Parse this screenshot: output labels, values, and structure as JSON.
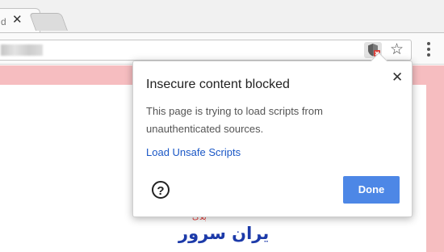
{
  "tabs": {
    "active_title_fragment": "d",
    "close_glyph": "✕"
  },
  "toolbar": {
    "shield_icon": "blocked-content-shield",
    "star_icon": "bookmark-star",
    "menu_icon": "vertical-dots",
    "star_glyph": "☆"
  },
  "popup": {
    "title": "Insecure content blocked",
    "close_glyph": "✕",
    "message": "This page is trying to load scripts from unauthenticated sources.",
    "link": "Load Unsafe Scripts",
    "help_glyph": "?",
    "done": "Done"
  },
  "logo": {
    "text": "ایران سرور",
    "subtext": "بلاگ",
    "color": "#1c3aa9"
  },
  "colors": {
    "page_background": "#f6bdc0",
    "done_button": "#4d87e6",
    "link": "#1a57c6",
    "shield_badge": "#d9403a"
  }
}
